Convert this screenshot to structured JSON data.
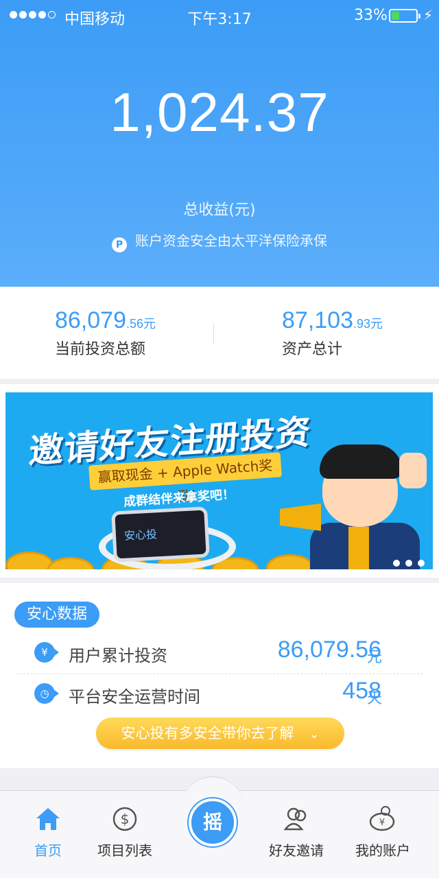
{
  "status_bar": {
    "carrier": "中国移动",
    "time": "下午3:17",
    "battery_percent": "33%",
    "battery_level": 0.33
  },
  "header": {
    "total_income": "1,024.37",
    "total_income_label": "总收益(元)",
    "insurance_note": "账户资金安全由太平洋保险承保"
  },
  "summary": {
    "invest_value": "86,079",
    "invest_decimal": ".56元",
    "invest_label": "当前投资总额",
    "assets_value": "87,103",
    "assets_decimal": ".93元",
    "assets_label": "资产总计"
  },
  "banner": {
    "title": "邀请好友注册投资",
    "ribbon": "赢取现金 + Apple Watch奖励!",
    "subtitle": "成群结伴来拿奖吧！",
    "watch_brand": "安心投",
    "slide_count": 3
  },
  "safety": {
    "tag": "安心数据",
    "rows": [
      {
        "icon": "yen-icon",
        "icon_glyph": "¥",
        "label": "用户累计投资",
        "value": "86,079.56",
        "unit": "元"
      },
      {
        "icon": "clock-icon",
        "icon_glyph": "◷",
        "label": "平台安全运营时间",
        "value": "458",
        "unit": "天"
      }
    ],
    "cta": "安心投有多安全带你去了解"
  },
  "tabs": [
    {
      "label": "首页",
      "icon": "home-icon",
      "active": true
    },
    {
      "label": "项目列表",
      "icon": "dollar-icon",
      "active": false
    },
    {
      "label": "摇",
      "icon": "shake-icon",
      "active": false
    },
    {
      "label": "好友邀请",
      "icon": "friends-icon",
      "active": false
    },
    {
      "label": "我的账户",
      "icon": "piggy-bank-icon",
      "active": false
    }
  ],
  "colors": {
    "accent": "#3c9cf6",
    "cta": "#f9b92b",
    "battery": "#4cd964"
  }
}
